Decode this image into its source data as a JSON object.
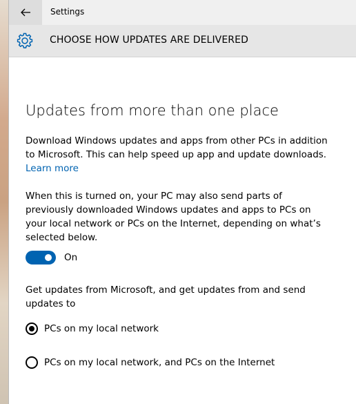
{
  "window": {
    "app_title": "Settings"
  },
  "header": {
    "title": "CHOOSE HOW UPDATES ARE DELIVERED",
    "icon": "gear-icon"
  },
  "main": {
    "section_title": "Updates from more than one place",
    "intro": "Download Windows updates and apps from other PCs in addition to Microsoft. This can help speed up app and update downloads.",
    "learn_more": "Learn more",
    "description": "When this is turned on, your PC may also send parts of previously downloaded Windows updates and apps to PCs on your local network or PCs on the Internet, depending on what’s selected below.",
    "toggle": {
      "state": "On",
      "enabled": true
    },
    "choice_prompt": "Get updates from Microsoft, and get updates from and send updates to",
    "options": [
      {
        "label": "PCs on my local network",
        "selected": true
      },
      {
        "label": "PCs on my local network, and PCs on the Internet",
        "selected": false
      }
    ]
  },
  "colors": {
    "accent": "#0063b1",
    "header_bg": "#e6e6e6"
  }
}
